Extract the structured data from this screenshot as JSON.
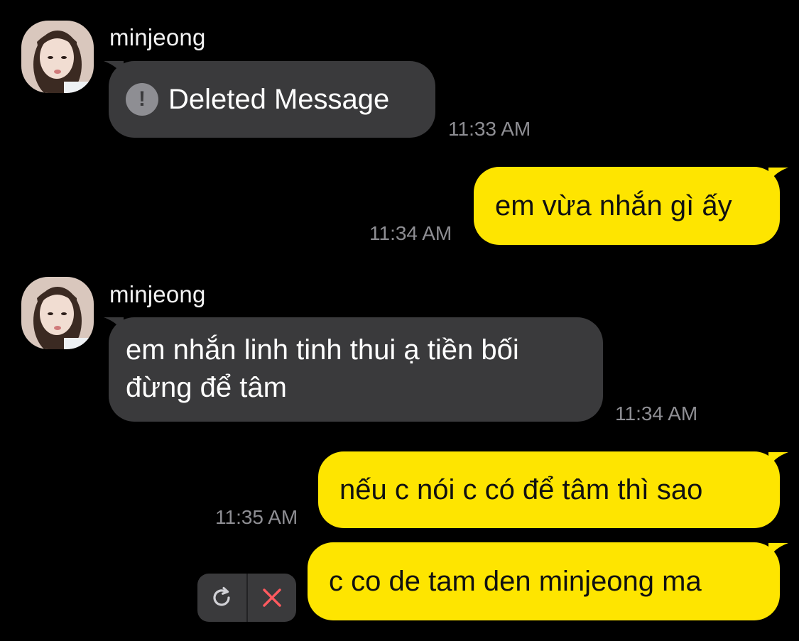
{
  "colors": {
    "background": "#000000",
    "incoming_bubble": "#3a3a3c",
    "outgoing_bubble": "#fee500",
    "timestamp": "#8e8e93",
    "cancel_icon": "#ff5a5f"
  },
  "messages": [
    {
      "direction": "incoming",
      "sender": "minjeong",
      "deleted": true,
      "warning_icon_glyph": "!",
      "text": "Deleted Message",
      "time": "11:33 AM"
    },
    {
      "direction": "outgoing",
      "text": "em vừa nhắn gì ấy",
      "time": "11:34 AM"
    },
    {
      "direction": "incoming",
      "sender": "minjeong",
      "lines": [
        "em nhắn linh tinh thui ạ tiền bối",
        "đừng để tâm"
      ],
      "time": "11:34 AM"
    },
    {
      "direction": "outgoing",
      "text": "nếu c nói c có để tâm thì sao",
      "time": "11:35 AM"
    },
    {
      "direction": "outgoing",
      "text": "c co de tam den minjeong ma",
      "failed": true,
      "actions": {
        "retry_icon": "refresh-icon",
        "cancel_icon": "close-icon"
      }
    }
  ]
}
